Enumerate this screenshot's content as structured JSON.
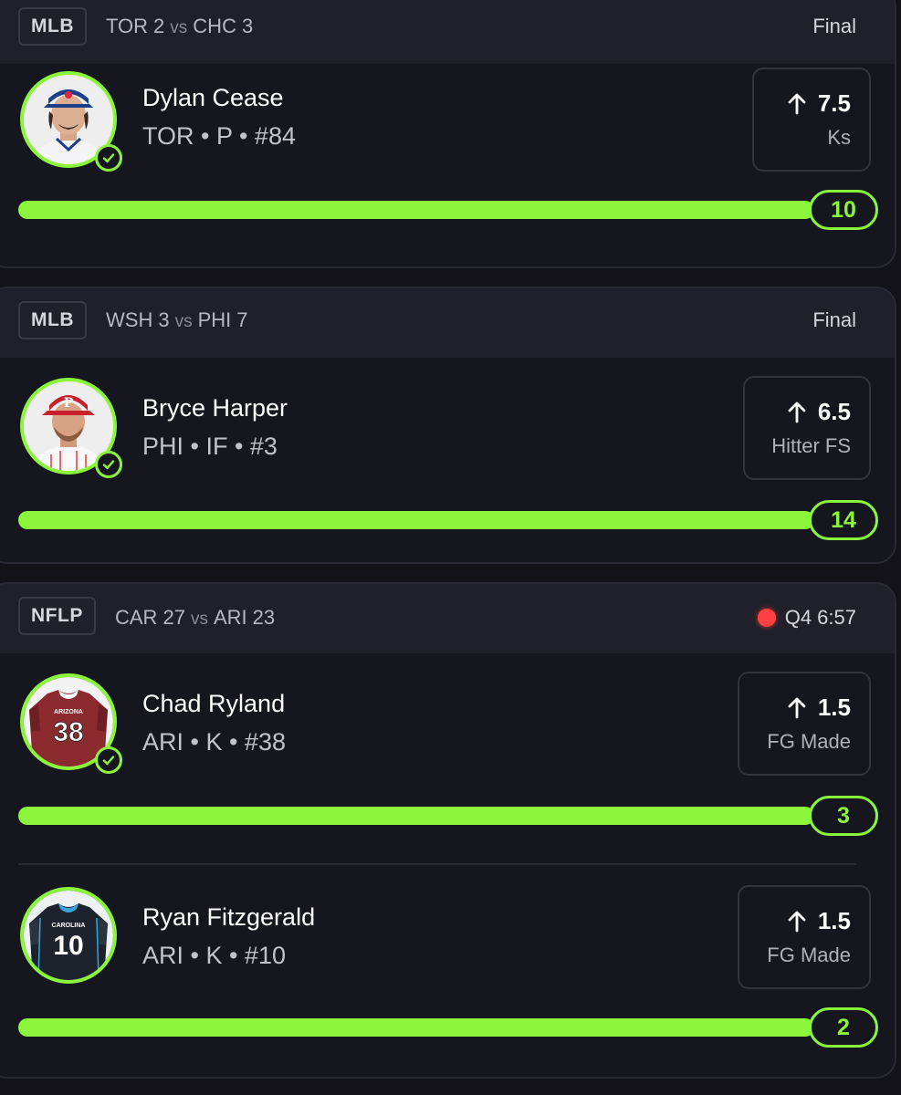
{
  "colors": {
    "accent": "#8bf53c",
    "live": "#ff4040",
    "background": "#121218",
    "card": "#16161f",
    "header": "#20202b"
  },
  "games": [
    {
      "league": "MLB",
      "away_team": "TOR",
      "away_score": "2",
      "vs": "vs",
      "home_team": "CHC",
      "home_score": "3",
      "status": "Final",
      "live": false,
      "players": [
        {
          "name": "Dylan Cease",
          "team": "TOR",
          "position": "P",
          "number": "#84",
          "meta": "TOR • P • #84",
          "direction": "up-arrow-icon",
          "line": "7.5",
          "stat": "Ks",
          "result": "10",
          "progress": 1.0,
          "avatar": "headshot-cease"
        }
      ]
    },
    {
      "league": "MLB",
      "away_team": "WSH",
      "away_score": "3",
      "vs": "vs",
      "home_team": "PHI",
      "home_score": "7",
      "status": "Final",
      "live": false,
      "players": [
        {
          "name": "Bryce Harper",
          "meta": "PHI • IF • #3",
          "direction": "up-arrow-icon",
          "line": "6.5",
          "stat": "Hitter FS",
          "result": "14",
          "progress": 1.0,
          "avatar": "headshot-harper"
        }
      ]
    },
    {
      "league": "NFLP",
      "away_team": "CAR",
      "away_score": "27",
      "vs": "vs",
      "home_team": "ARI",
      "home_score": "23",
      "status": "Q4 6:57",
      "live": true,
      "players": [
        {
          "name": "Chad Ryland",
          "meta": "ARI • K • #38",
          "direction": "up-arrow-icon",
          "line": "1.5",
          "stat": "FG Made",
          "result": "3",
          "progress": 1.0,
          "avatar": "jersey-arizona-38",
          "jersey_text": "ARIZONA",
          "jersey_number": "38"
        },
        {
          "name": "Ryan Fitzgerald",
          "meta": "ARI • K • #10",
          "direction": "up-arrow-icon",
          "line": "1.5",
          "stat": "FG Made",
          "result": "2",
          "progress": 1.0,
          "avatar": "jersey-carolina-10",
          "jersey_text": "CAROLINA",
          "jersey_number": "10"
        }
      ]
    }
  ]
}
